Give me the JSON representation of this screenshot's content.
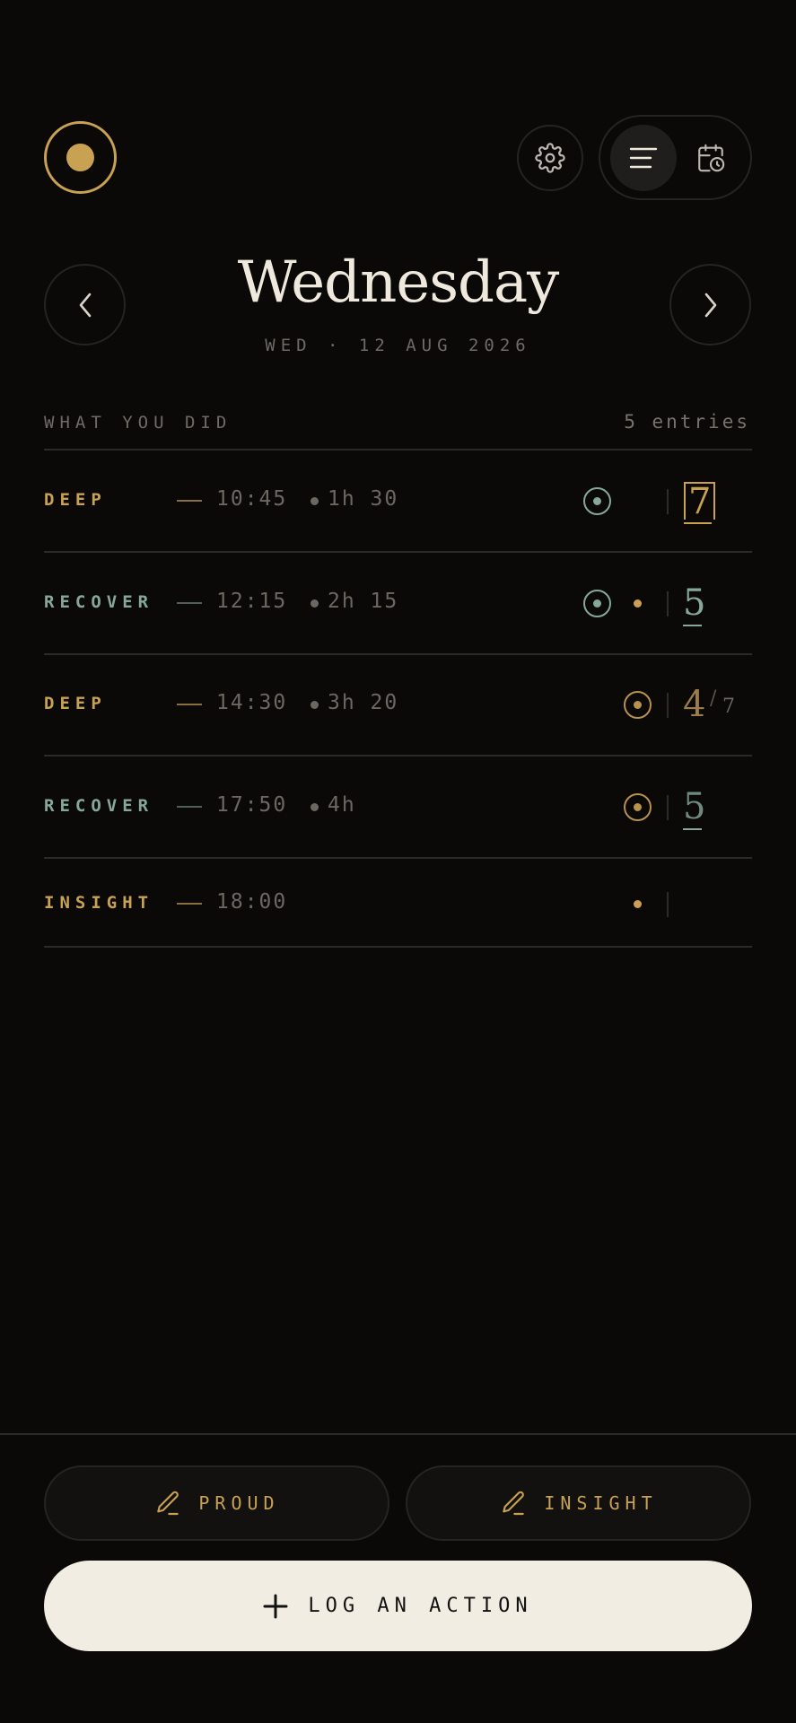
{
  "header": {
    "logo_icon": "target-dot-icon",
    "settings_icon": "gear-icon",
    "view_modes": [
      {
        "icon": "list-icon",
        "selected": true
      },
      {
        "icon": "calendar-clock-icon",
        "selected": false
      }
    ]
  },
  "date_nav": {
    "prev_icon": "chevron-left-icon",
    "next_icon": "chevron-right-icon",
    "day": "Wednesday",
    "date_line": "WED · 12 AUG 2026"
  },
  "section": {
    "label": "WHAT YOU DID",
    "count": "5 entries"
  },
  "entries": [
    {
      "tag": "DEEP",
      "time": "10:45",
      "duration": "1h 30",
      "score": "7",
      "score_max": "",
      "color": "#c8a152"
    },
    {
      "tag": "RECOVER",
      "time": "12:15",
      "duration": "2h 15",
      "score": "5",
      "score_max": "",
      "color": "#86a89a"
    },
    {
      "tag": "DEEP",
      "time": "14:30",
      "duration": "3h 20",
      "score": "4",
      "score_max": "7",
      "color": "#c8a152"
    },
    {
      "tag": "RECOVER",
      "time": "17:50",
      "duration": "4h",
      "score": "5",
      "score_max": "",
      "color": "#86a89a"
    },
    {
      "tag": "INSIGHT",
      "time": "18:00",
      "duration": "",
      "score": "",
      "score_max": "",
      "color": "#c8a152"
    }
  ],
  "actions": {
    "proud_label": "PROUD",
    "insight_label": "INSIGHT",
    "log_label": "LOG AN ACTION",
    "pen_icon": "pen-icon",
    "plus_icon": "plus-icon"
  },
  "colors": {
    "background": "#0a0908",
    "gold": "#c8a152",
    "teal": "#86a89a",
    "cream": "#f2ede3"
  }
}
